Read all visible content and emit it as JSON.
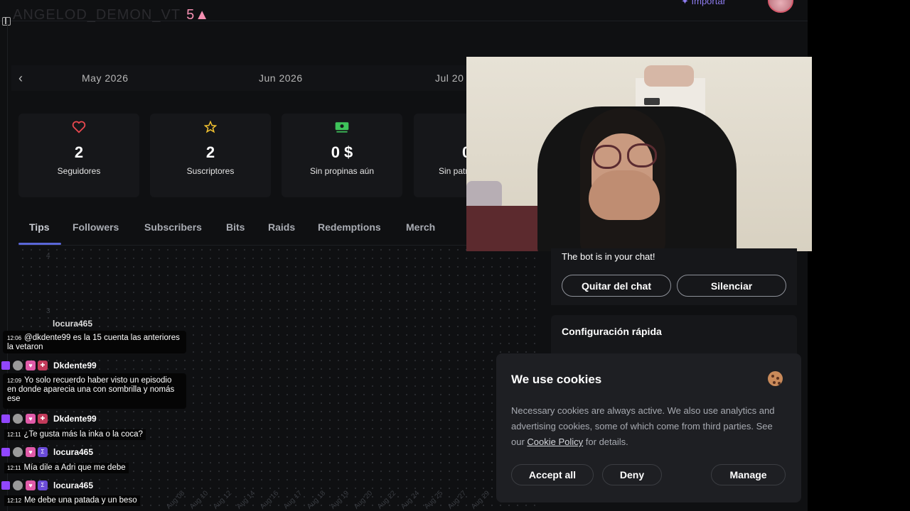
{
  "header": {
    "channel_name": "ANGELOD_DEMON_VT",
    "channel_badge": "5",
    "import_label": "Importar"
  },
  "calendar": {
    "months": [
      "May 2026",
      "Jun 2026",
      "Jul 20"
    ]
  },
  "stats": [
    {
      "icon": "heart-icon",
      "value": "2",
      "label": "Seguidores"
    },
    {
      "icon": "star-icon",
      "value": "2",
      "label": "Suscriptores"
    },
    {
      "icon": "money-icon",
      "value": "0 $",
      "label": "Sin propinas aún"
    },
    {
      "icon": "patron-icon",
      "value": "0",
      "label": "Sin patr"
    }
  ],
  "tabs": [
    "Tips",
    "Followers",
    "Subscribers",
    "Bits",
    "Raids",
    "Redemptions",
    "Merch"
  ],
  "chart": {
    "y_ticks": [
      "4",
      "3"
    ],
    "x_ticks": [
      "Aug 08",
      "Aug 10",
      "Aug 12",
      "Aug 14",
      "Aug 16",
      "Aug 17",
      "Aug 18",
      "Aug 19",
      "Aug 20",
      "Aug 22",
      "Aug 24",
      "Aug 25",
      "Aug 27",
      "Aug 29"
    ]
  },
  "chat": {
    "top_user": "locura465",
    "messages": [
      {
        "user": "",
        "time": "12:06",
        "text": "@dkdente99 es la 15 cuenta las anteriores la vetaron"
      },
      {
        "user": "Dkdente99",
        "time": "12:09",
        "text": "Yo solo recuerdo haber visto un episodio en donde aparecia una con sombrilla y nomás ese"
      },
      {
        "user": "Dkdente99",
        "time": "12:11",
        "text": "¿Te gusta más la inka o la coca?"
      },
      {
        "user": "locura465",
        "time": "12:11",
        "text": "Mía dile a Adri que me debe"
      },
      {
        "user": "locura465",
        "time": "12:12",
        "text": "Me debe una patada y un beso"
      }
    ]
  },
  "bot": {
    "status": "The bot is in your chat!",
    "remove_label": "Quitar del chat",
    "mute_label": "Silenciar",
    "quick_config": "Configuración rápida"
  },
  "cookies": {
    "title": "We use cookies",
    "text_before": "Necessary cookies are always active. We also use analytics and advertising cookies, some of which come from third parties. See our ",
    "policy_link": "Cookie Policy",
    "text_after": " for details.",
    "accept": "Accept all",
    "deny": "Deny",
    "manage": "Manage"
  }
}
